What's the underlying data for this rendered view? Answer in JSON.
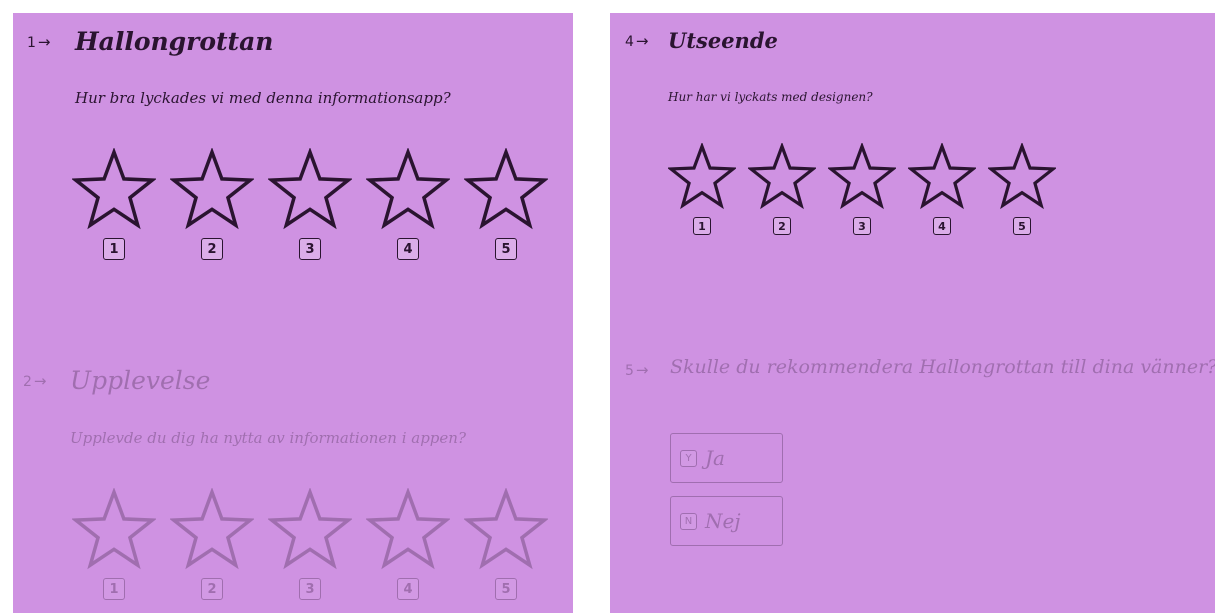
{
  "left": {
    "q1": {
      "number": "1",
      "title": "Hallongrottan",
      "subtitle": "Hur bra lyckades vi med denna informationsapp?",
      "keys": [
        "1",
        "2",
        "3",
        "4",
        "5"
      ]
    },
    "q2": {
      "number": "2",
      "title": "Upplevelse",
      "subtitle": "Upplevde du dig ha nytta av informationen i appen?",
      "keys": [
        "1",
        "2",
        "3",
        "4",
        "5"
      ]
    }
  },
  "right": {
    "q4": {
      "number": "4",
      "title": "Utseende",
      "subtitle": "Hur har vi lyckats med designen?",
      "keys": [
        "1",
        "2",
        "3",
        "4",
        "5"
      ]
    },
    "q5": {
      "number": "5",
      "title": "Skulle du rekommendera Hallongrottan till dina vänner?",
      "choices": [
        {
          "key": "Y",
          "label": "Ja"
        },
        {
          "key": "N",
          "label": "Nej"
        }
      ]
    }
  },
  "arrow": "→",
  "colors": {
    "background": "#cf92e2",
    "text": "#2a1430"
  }
}
